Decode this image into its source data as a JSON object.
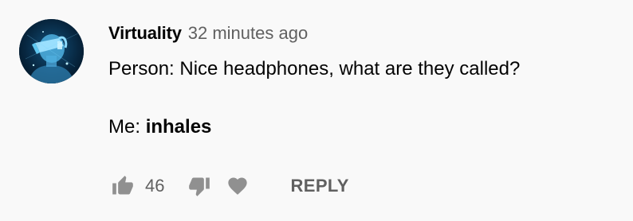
{
  "comment": {
    "author": "Virtuality",
    "timestamp": "32 minutes ago",
    "avatar_icon": "vr-headset-avatar",
    "text_line1": "Person: Nice headphones, what are they called?",
    "text_line2_prefix": "Me: ",
    "text_line2_bold": "inhales"
  },
  "actions": {
    "like_icon": "thumbs-up-icon",
    "like_count": "46",
    "dislike_icon": "thumbs-down-icon",
    "heart_icon": "heart-icon",
    "reply_label": "REPLY"
  },
  "colors": {
    "background": "#f9f9f9",
    "text_primary": "#030303",
    "text_secondary": "#606060",
    "icon_gray": "#909090",
    "avatar_background": "#06223a",
    "avatar_glow": "#5fc7f0"
  }
}
